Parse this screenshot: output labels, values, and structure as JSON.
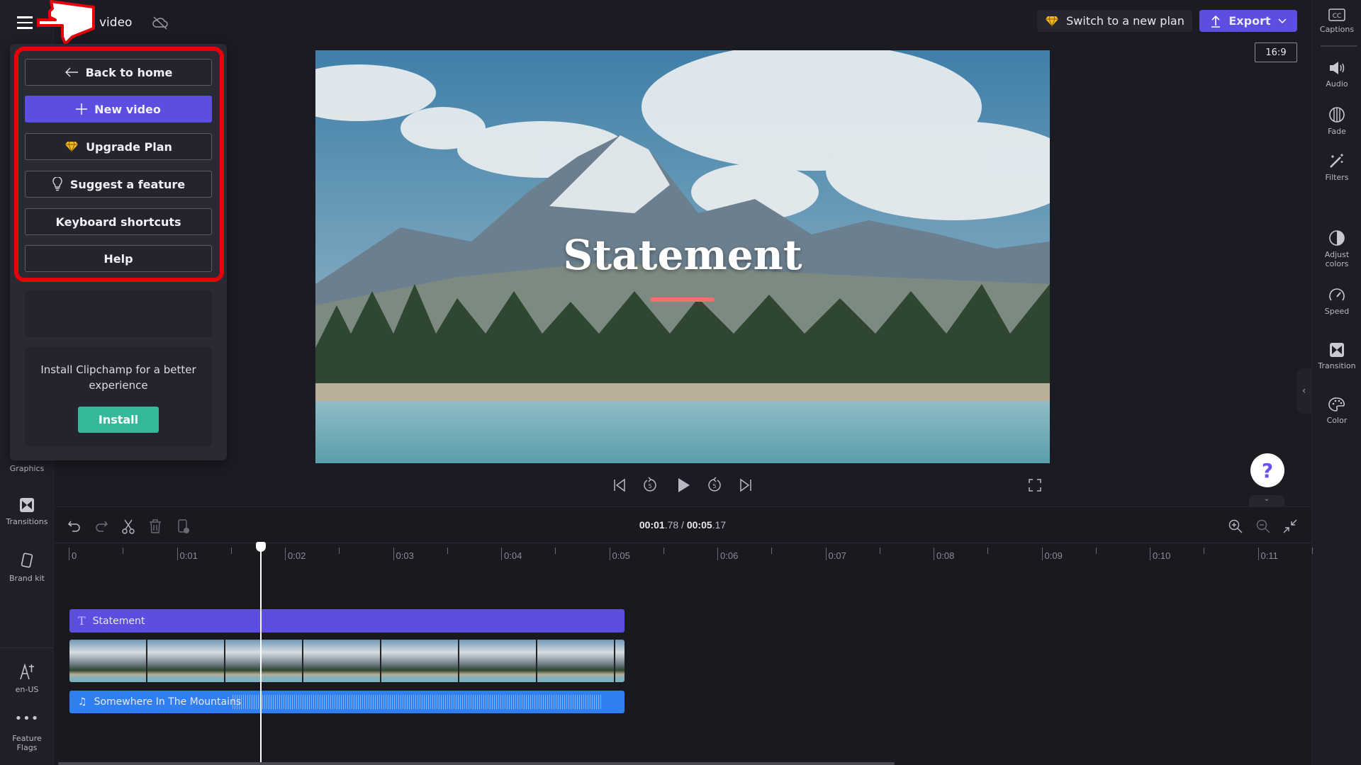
{
  "header": {
    "project_title": "video",
    "cloud_status_icon": "cloud-off-icon",
    "switch_plan_label": "Switch to a new plan",
    "export_label": "Export",
    "aspect_ratio": "16:9"
  },
  "menu": {
    "items": [
      {
        "label": "Back to home",
        "icon": "arrow-left-icon"
      },
      {
        "label": "New video",
        "icon": "plus-icon"
      },
      {
        "label": "Upgrade Plan",
        "icon": "diamond-icon"
      },
      {
        "label": "Suggest a feature",
        "icon": "lightbulb-icon"
      },
      {
        "label": "Keyboard shortcuts"
      },
      {
        "label": "Help"
      }
    ],
    "install_text": "Install Clipchamp for a better experience",
    "install_label": "Install"
  },
  "left_sidebar": {
    "items": [
      {
        "label": "Graphics"
      },
      {
        "label": "Transitions"
      },
      {
        "label": "Brand kit"
      },
      {
        "label": "en-US"
      },
      {
        "label": "Feature Flags"
      }
    ]
  },
  "right_panel": {
    "items": [
      {
        "label": "Captions"
      },
      {
        "label": "Audio"
      },
      {
        "label": "Fade"
      },
      {
        "label": "Filters"
      },
      {
        "label": "Adjust colors"
      },
      {
        "label": "Speed"
      },
      {
        "label": "Transition"
      },
      {
        "label": "Color"
      }
    ]
  },
  "preview": {
    "overlay_text": "Statement"
  },
  "timeline": {
    "current_time_main": "00:01",
    "current_time_frac": ".78",
    "separator": "/",
    "total_time_main": "00:05",
    "total_time_frac": ".17",
    "ruler_labels": [
      "0",
      "0:01",
      "0:02",
      "0:03",
      "0:04",
      "0:05",
      "0:06",
      "0:07",
      "0:08",
      "0:09",
      "0:10",
      "0:11"
    ],
    "playhead_seconds": 1.78,
    "tracks": {
      "text_clip": "Statement",
      "audio_clip": "Somewhere In The Mountains"
    }
  },
  "colors": {
    "accent": "#5b4ee0",
    "install": "#36b99a",
    "annotation": "#e8000b",
    "audio_clip": "#2f7ff0"
  }
}
